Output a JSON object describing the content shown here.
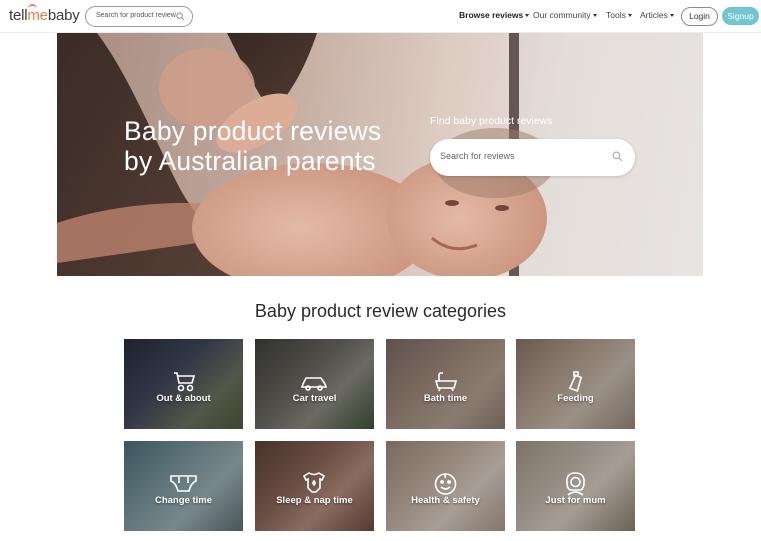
{
  "header": {
    "logo": {
      "part1": "tell",
      "part2": "me",
      "part3": "baby"
    },
    "search_placeholder": "Search for product reviews",
    "nav": [
      {
        "label": "Browse reviews"
      },
      {
        "label": "Our community"
      },
      {
        "label": "Tools"
      },
      {
        "label": "Articles"
      }
    ],
    "login_label": "Login",
    "signup_label": "Signup"
  },
  "hero": {
    "title_line1": "Baby product reviews",
    "title_line2": "by Australian parents",
    "find_label": "Find baby product reviews",
    "search_placeholder": "Search for reviews"
  },
  "categories": {
    "heading": "Baby product review categories",
    "items": [
      {
        "label": "Out & about",
        "icon": "stroller-icon"
      },
      {
        "label": "Car travel",
        "icon": "car-icon"
      },
      {
        "label": "Bath time",
        "icon": "bathtub-icon"
      },
      {
        "label": "Feeding",
        "icon": "baby-bottle-icon"
      },
      {
        "label": "Change time",
        "icon": "nappy-icon"
      },
      {
        "label": "Sleep & nap time",
        "icon": "onesie-icon"
      },
      {
        "label": "Health & safety",
        "icon": "baby-face-icon"
      },
      {
        "label": "Just for mum",
        "icon": "mum-icon"
      }
    ]
  },
  "colors": {
    "brand_orange": "#ee7b4a",
    "signup_teal": "#6fc6d1",
    "text_dark": "#2b2b2b"
  }
}
